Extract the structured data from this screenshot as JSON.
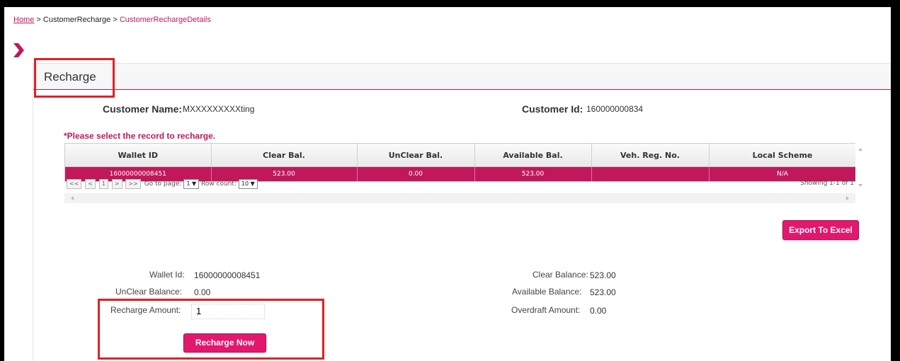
{
  "breadcrumb": {
    "home": "Home",
    "sep1": ">",
    "item1": "CustomerRecharge",
    "sep2": ">",
    "current": "CustomerRechargeDetails"
  },
  "panel": {
    "title": "Recharge"
  },
  "customer": {
    "name_label": "Customer Name:",
    "name_value": "MXXXXXXXXXting",
    "id_label": "Customer Id:",
    "id_value": "160000000834"
  },
  "notice": "*Please select the record to recharge.",
  "table": {
    "columns": [
      "Wallet ID",
      "Clear Bal.",
      "UnClear Bal.",
      "Available Bal.",
      "Veh. Reg. No.",
      "Local Scheme"
    ],
    "rows": [
      [
        "16000000008451",
        "523.00",
        "0.00",
        "523.00",
        "",
        "N/A"
      ]
    ]
  },
  "pager": {
    "first": "<<",
    "prev": "<",
    "page": "1",
    "next": ">",
    "last": ">>",
    "goto_label": "Go to page:",
    "goto_value": "1 ▼",
    "rowcount_label": "Row count:",
    "rowcount_value": "10 ▼",
    "showing": "Showing 1-1 of 1"
  },
  "export_button": "Export To Excel",
  "details": {
    "wallet_id_label": "Wallet Id:",
    "wallet_id_value": "16000000008451",
    "unclear_label": "UnClear Balance:",
    "unclear_value": "0.00",
    "recharge_label": "Recharge Amount:",
    "recharge_value": "1",
    "clear_label": "Clear Balance:",
    "clear_value": "523.00",
    "available_label": "Available Balance:",
    "available_value": "523.00",
    "overdraft_label": "Overdraft Amount:",
    "overdraft_value": "0.00"
  },
  "recharge_button": "Recharge Now",
  "colors": {
    "accent": "#c2185b",
    "button": "#e2186f",
    "annotation": "#e21f26"
  }
}
